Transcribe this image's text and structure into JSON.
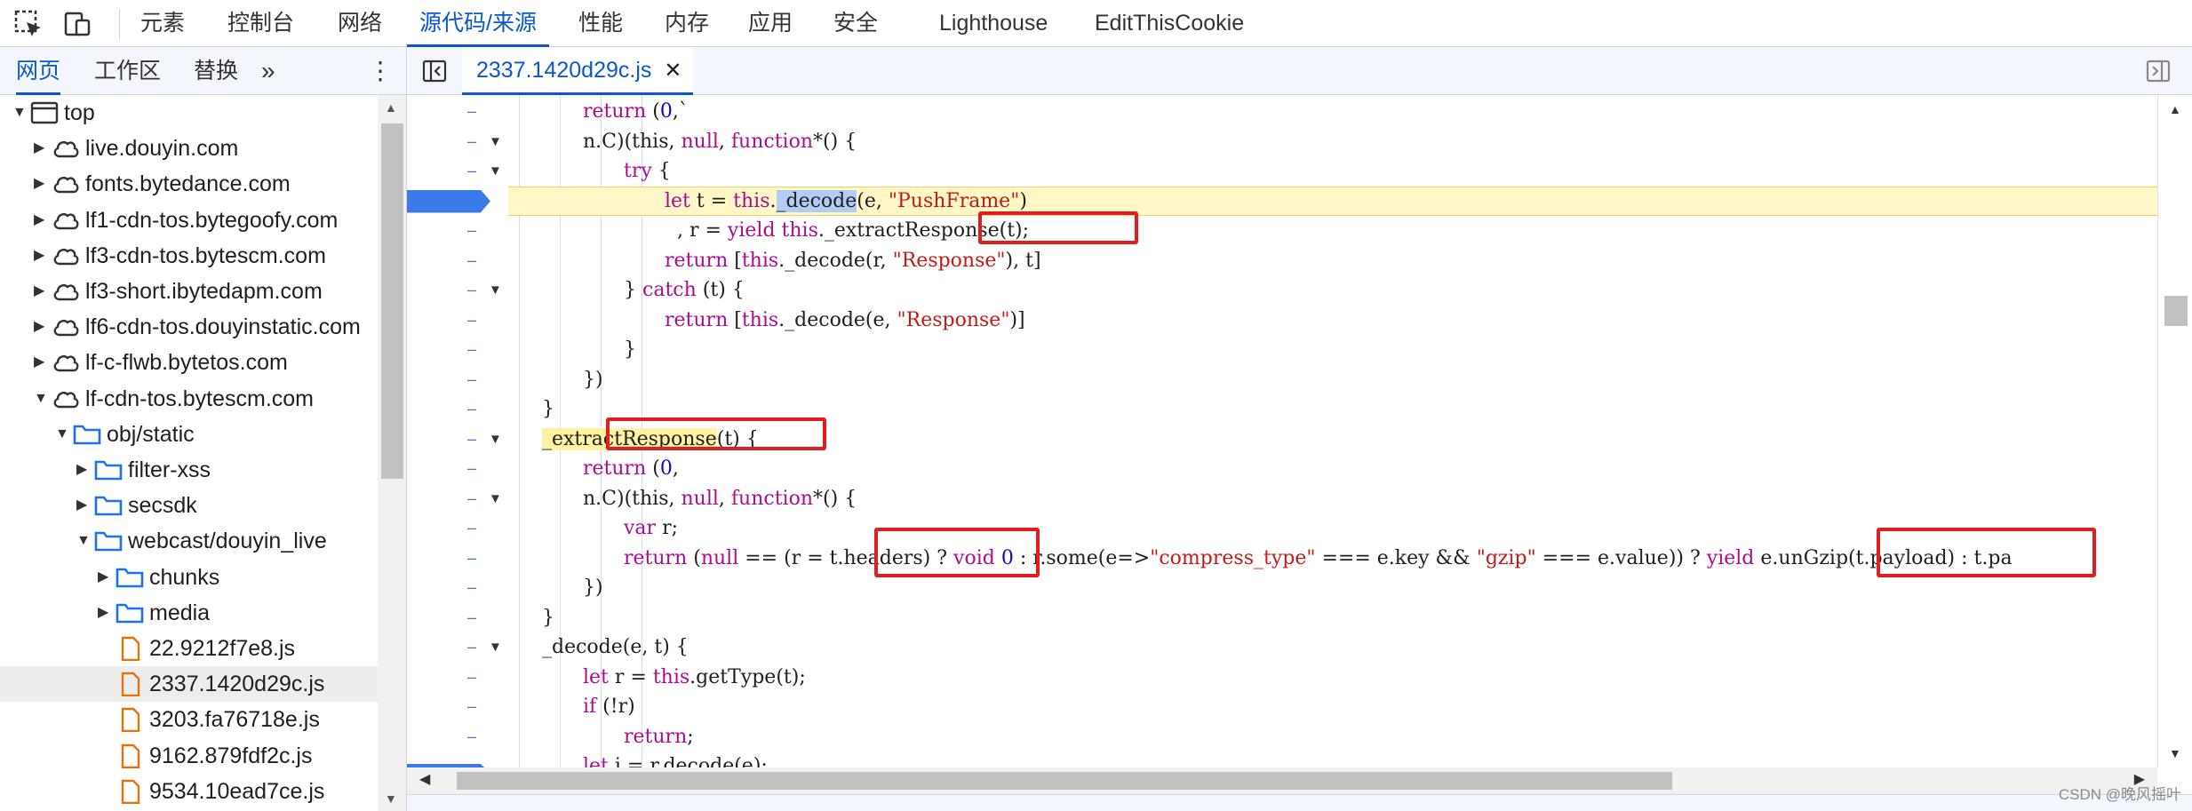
{
  "toolbar": {
    "inspect_icon": "inspect-icon",
    "device_icon": "device-toggle-icon",
    "tabs": [
      {
        "label": "元素",
        "active": false
      },
      {
        "label": "控制台",
        "active": false
      },
      {
        "label": "网络",
        "active": false
      },
      {
        "label": "源代码/来源",
        "active": true
      },
      {
        "label": "性能",
        "active": false
      },
      {
        "label": "内存",
        "active": false
      },
      {
        "label": "应用",
        "active": false
      },
      {
        "label": "安全",
        "active": false
      },
      {
        "label": "Lighthouse",
        "active": false
      },
      {
        "label": "EditThisCookie",
        "active": false
      }
    ]
  },
  "navigator": {
    "tabs": [
      "网页",
      "工作区",
      "替换"
    ],
    "more": "»",
    "menu": "⋮",
    "tree": [
      {
        "label": "top",
        "type": "frame",
        "depth": 0,
        "expanded": true
      },
      {
        "label": "live.douyin.com",
        "type": "cloud",
        "depth": 1,
        "expanded": false
      },
      {
        "label": "fonts.bytedance.com",
        "type": "cloud",
        "depth": 1,
        "expanded": false
      },
      {
        "label": "lf1-cdn-tos.bytegoofy.com",
        "type": "cloud",
        "depth": 1,
        "expanded": false
      },
      {
        "label": "lf3-cdn-tos.bytescm.com",
        "type": "cloud",
        "depth": 1,
        "expanded": false
      },
      {
        "label": "lf3-short.ibytedapm.com",
        "type": "cloud",
        "depth": 1,
        "expanded": false
      },
      {
        "label": "lf6-cdn-tos.douyinstatic.com",
        "type": "cloud",
        "depth": 1,
        "expanded": false
      },
      {
        "label": "lf-c-flwb.bytetos.com",
        "type": "cloud",
        "depth": 1,
        "expanded": false
      },
      {
        "label": "lf-cdn-tos.bytescm.com",
        "type": "cloud",
        "depth": 1,
        "expanded": true
      },
      {
        "label": "obj/static",
        "type": "folder",
        "depth": 2,
        "expanded": true
      },
      {
        "label": "filter-xss",
        "type": "folder",
        "depth": 3,
        "expanded": false
      },
      {
        "label": "secsdk",
        "type": "folder",
        "depth": 3,
        "expanded": false
      },
      {
        "label": "webcast/douyin_live",
        "type": "folder",
        "depth": 3,
        "expanded": true
      },
      {
        "label": "chunks",
        "type": "folder",
        "depth": 4,
        "expanded": false
      },
      {
        "label": "media",
        "type": "folder",
        "depth": 4,
        "expanded": false
      },
      {
        "label": "22.9212f7e8.js",
        "type": "file",
        "depth": 4
      },
      {
        "label": "2337.1420d29c.js",
        "type": "file",
        "depth": 4,
        "selected": true
      },
      {
        "label": "3203.fa76718e.js",
        "type": "file",
        "depth": 4
      },
      {
        "label": "9162.879fdf2c.js",
        "type": "file",
        "depth": 4
      },
      {
        "label": "9534.10ead7ce.js",
        "type": "file",
        "depth": 4
      }
    ]
  },
  "editor": {
    "file_tab": "2337.1420d29c.js",
    "close": "✕",
    "watermark": "CSDN @晚风摇叶",
    "lines": [
      {
        "indent": 3,
        "fold": false,
        "segs": [
          [
            "k",
            "return "
          ],
          [
            "m",
            "("
          ],
          [
            "n",
            "0"
          ],
          [
            "m",
            ",`"
          ]
        ]
      },
      {
        "indent": 3,
        "fold": true,
        "segs": [
          [
            "m",
            "n.C)(this, "
          ],
          [
            "k",
            "null"
          ],
          [
            "m",
            ", "
          ],
          [
            "k",
            "function"
          ],
          [
            "m",
            "*() {"
          ]
        ]
      },
      {
        "indent": 4,
        "fold": true,
        "segs": [
          [
            "k",
            "try"
          ],
          [
            "m",
            " {"
          ]
        ]
      },
      {
        "indent": 5,
        "fold": false,
        "paused": true,
        "segs": [
          [
            "k",
            "let "
          ],
          [
            "m",
            "t = "
          ],
          [
            "k",
            "this"
          ],
          [
            "m",
            "."
          ],
          [
            "hl",
            "_decode"
          ],
          [
            "m",
            "(e, "
          ],
          [
            "s",
            "\"PushFrame\""
          ],
          [
            "m",
            ")"
          ]
        ]
      },
      {
        "indent": 5,
        "fold": false,
        "segs": [
          [
            "m",
            "  , r = "
          ],
          [
            "k",
            "yield "
          ],
          [
            "k",
            "this"
          ],
          [
            "m",
            "._extractResponse(t);"
          ]
        ]
      },
      {
        "indent": 5,
        "fold": false,
        "segs": [
          [
            "k",
            "return "
          ],
          [
            "m",
            "["
          ],
          [
            "k",
            "this"
          ],
          [
            "m",
            "._decode(r, "
          ],
          [
            "s",
            "\"Response\""
          ],
          [
            "m",
            "), t]"
          ]
        ]
      },
      {
        "indent": 4,
        "fold": true,
        "segs": [
          [
            "m",
            "} "
          ],
          [
            "k",
            "catch"
          ],
          [
            "m",
            " (t) {"
          ]
        ]
      },
      {
        "indent": 5,
        "fold": false,
        "segs": [
          [
            "k",
            "return "
          ],
          [
            "m",
            "["
          ],
          [
            "k",
            "this"
          ],
          [
            "m",
            "._decode(e, "
          ],
          [
            "s",
            "\"Response\""
          ],
          [
            "m",
            ")]"
          ]
        ]
      },
      {
        "indent": 4,
        "fold": false,
        "segs": [
          [
            "m",
            "}"
          ]
        ]
      },
      {
        "indent": 3,
        "fold": false,
        "segs": [
          [
            "m",
            "})"
          ]
        ]
      },
      {
        "indent": 2,
        "fold": false,
        "segs": [
          [
            "m",
            "}"
          ]
        ]
      },
      {
        "indent": 2,
        "fold": true,
        "segs": [
          [
            "hly",
            "_extractResponse"
          ],
          [
            "m",
            "(t) {"
          ]
        ]
      },
      {
        "indent": 3,
        "fold": false,
        "segs": [
          [
            "k",
            "return "
          ],
          [
            "m",
            "("
          ],
          [
            "n",
            "0"
          ],
          [
            "m",
            ","
          ]
        ]
      },
      {
        "indent": 3,
        "fold": true,
        "segs": [
          [
            "m",
            "n.C)(this, "
          ],
          [
            "k",
            "null"
          ],
          [
            "m",
            ", "
          ],
          [
            "k",
            "function"
          ],
          [
            "m",
            "*() {"
          ]
        ]
      },
      {
        "indent": 4,
        "fold": false,
        "segs": [
          [
            "k",
            "var "
          ],
          [
            "m",
            "r;"
          ]
        ]
      },
      {
        "indent": 4,
        "fold": false,
        "segs": [
          [
            "k",
            "return "
          ],
          [
            "m",
            "("
          ],
          [
            "k",
            "null"
          ],
          [
            "m",
            " == (r = t.headers) ? "
          ],
          [
            "k",
            "void "
          ],
          [
            "n",
            "0"
          ],
          [
            "m",
            " : r.some(e=>"
          ],
          [
            "s",
            "\"compress_type\""
          ],
          [
            "m",
            " === e.key && "
          ],
          [
            "s",
            "\"gzip\""
          ],
          [
            "m",
            " === e.value)) ? "
          ],
          [
            "k",
            "yield "
          ],
          [
            "m",
            "e.unGzip(t.payload) : t.pa"
          ]
        ]
      },
      {
        "indent": 3,
        "fold": false,
        "segs": [
          [
            "m",
            "})"
          ]
        ]
      },
      {
        "indent": 2,
        "fold": false,
        "segs": [
          [
            "m",
            "}"
          ]
        ]
      },
      {
        "indent": 2,
        "fold": true,
        "segs": [
          [
            "m",
            "_decode(e, t) {"
          ]
        ]
      },
      {
        "indent": 3,
        "fold": false,
        "segs": [
          [
            "k",
            "let "
          ],
          [
            "m",
            "r = "
          ],
          [
            "k",
            "this"
          ],
          [
            "m",
            ".getType(t);"
          ]
        ]
      },
      {
        "indent": 3,
        "fold": false,
        "segs": [
          [
            "k",
            "if "
          ],
          [
            "m",
            "(!r)"
          ]
        ]
      },
      {
        "indent": 4,
        "fold": false,
        "segs": [
          [
            "k",
            "return"
          ],
          [
            "m",
            ";"
          ]
        ]
      },
      {
        "indent": 3,
        "fold": false,
        "segs": [
          [
            "k",
            "let "
          ],
          [
            "m",
            "i = r.decode(e);"
          ]
        ]
      }
    ]
  }
}
